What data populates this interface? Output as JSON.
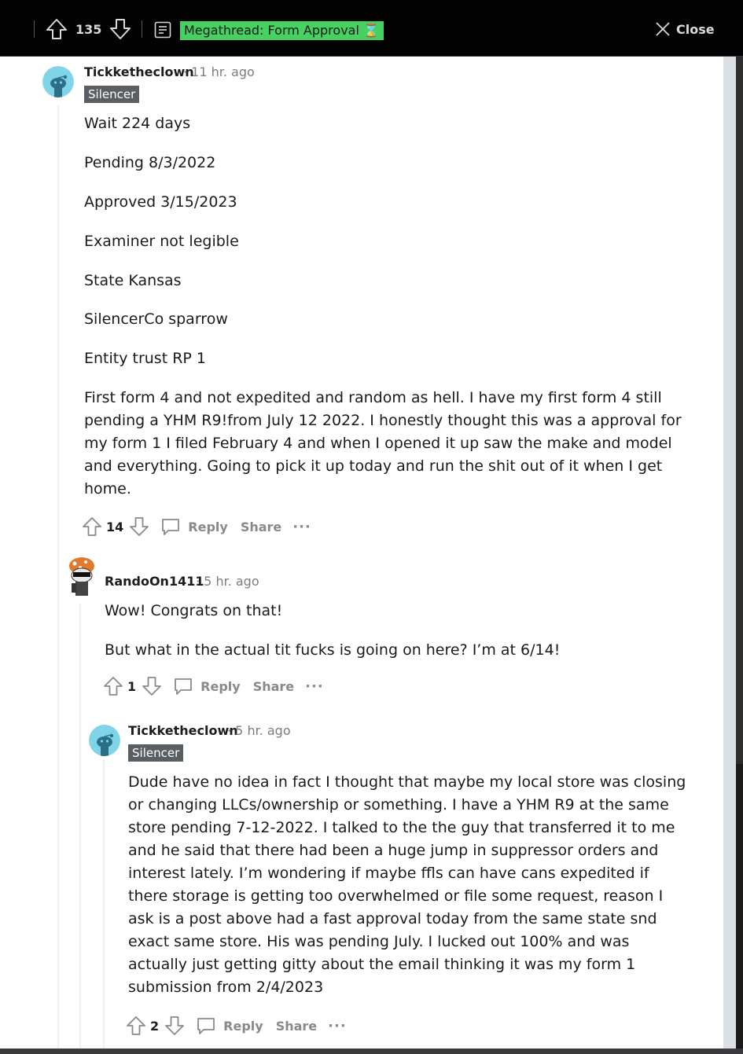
{
  "topbar": {
    "vote_count": "135",
    "post_title": "Megathread: Form Approval ⌛",
    "close_label": "Close"
  },
  "comments": [
    {
      "username": "Tickketheclown",
      "time": "· 11 hr. ago",
      "flair": "Silencer",
      "paragraphs": [
        "Wait 224 days",
        "Pending 8/3/2022",
        "Approved 3/15/2023",
        "Examiner not legible",
        "State Kansas",
        "SilencerCo sparrow",
        "Entity trust RP 1",
        "First form 4 and not expedited and random as hell. I have my first form 4 still\npending a YHM R9!from July 12 2022. I honestly thought this was a approval for\nmy form 1 I filed February 4 and when I opened it up saw the make and model\nand everything. Going to pick it up today and run the shit out of it when I get\nhome."
      ],
      "votes": "14",
      "reply": "Reply",
      "share": "Share",
      "more": "···"
    },
    {
      "username": "RandoOn1411",
      "time": "· 5 hr. ago",
      "paragraphs": [
        "Wow! Congrats on that!",
        "But what in the actual tit fucks is going on here? I’m at 6/14!"
      ],
      "votes": "1",
      "reply": "Reply",
      "share": "Share",
      "more": "···"
    },
    {
      "username": "Tickketheclown",
      "time": "· 5 hr. ago",
      "flair": "Silencer",
      "paragraphs": [
        "Dude have no idea in fact I thought that maybe my local store was closing\nor changing LLCs/ownership or something. I have a YHM R9 at the same\nstore pending 7-12-2022. I talked to the the guy that transferred it to me\nand he said that there had been a huge jump in suppressor orders and\ninterest lately. I’m wondering if maybe ffls can have cans expedited if\nthere storage is getting too overwhelmed or file some request, reason I\nask is a post above had a fast approval today from the same state snd\nexact same store. His was pending July. I lucked out 100% and was\nactually just getting gitty about the email thinking it was my form 1\nsubmission from 2/4/2023"
      ],
      "votes": "2",
      "reply": "Reply",
      "share": "Share",
      "more": "···"
    }
  ],
  "colors": {
    "topbar_bg": "#030303",
    "flair_title_bg": "#46d160",
    "user_flair_bg": "#5a5f63",
    "avatar_bg": "#7fd4e9"
  }
}
